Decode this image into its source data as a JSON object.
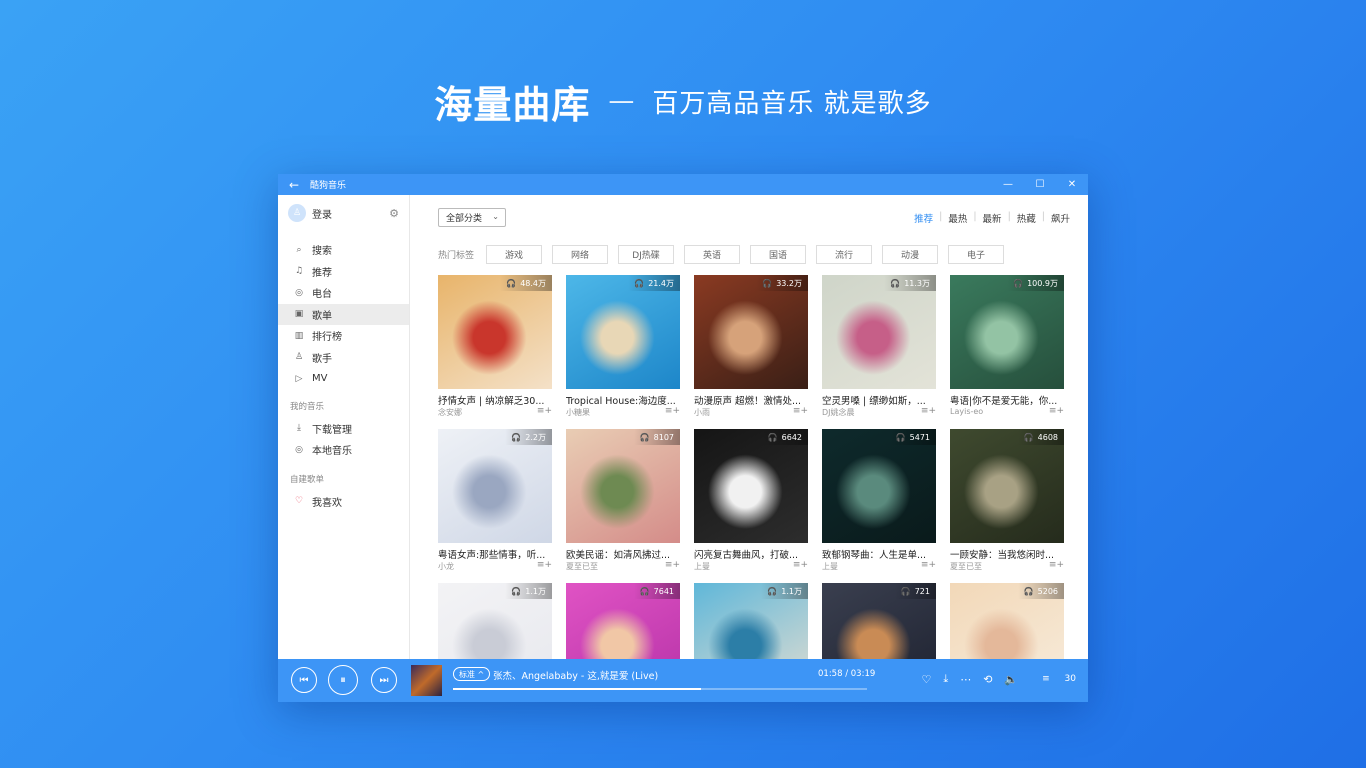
{
  "hero": {
    "title": "海量曲库",
    "dash": "—",
    "subtitle": "百万高品音乐 就是歌多"
  },
  "window": {
    "app_name": "酷狗音乐",
    "back_icon": "←",
    "min_icon": "—",
    "max_icon": "☐",
    "close_icon": "✕"
  },
  "sidebar": {
    "login_label": "登录",
    "nav": [
      {
        "label": "搜索",
        "icon": "⌕"
      },
      {
        "label": "推荐",
        "icon": "♫"
      },
      {
        "label": "电台",
        "icon": "◎"
      },
      {
        "label": "歌单",
        "icon": "▣"
      },
      {
        "label": "排行榜",
        "icon": "▥"
      },
      {
        "label": "歌手",
        "icon": "♙"
      },
      {
        "label": "MV",
        "icon": "▷"
      }
    ],
    "my_music_title": "我的音乐",
    "my_music": [
      {
        "label": "下载管理",
        "icon": "⤓"
      },
      {
        "label": "本地音乐",
        "icon": "◎"
      }
    ],
    "playlists_title": "自建歌单",
    "playlists": [
      {
        "label": "我喜欢",
        "icon": "♡"
      }
    ]
  },
  "main": {
    "category": "全部分类",
    "sorts": [
      "推荐",
      "最热",
      "最新",
      "热藏",
      "飙升"
    ],
    "tags_label": "热门标签",
    "tags": [
      "游戏",
      "网络",
      "DJ热碟",
      "英语",
      "国语",
      "流行",
      "动漫",
      "电子"
    ],
    "cards": [
      {
        "plays": "48.4万",
        "title": "抒情女声 | 纳凉解乏30...",
        "author": "念安娜",
        "colors": [
          "#e8b46a",
          "#c9362c",
          "#f4e1c8"
        ]
      },
      {
        "plays": "21.4万",
        "title": "Tropical House:海边度...",
        "author": "小糖果",
        "colors": [
          "#4db7e8",
          "#e8d7b6",
          "#1d86c9"
        ]
      },
      {
        "plays": "33.2万",
        "title": "动漫原声 超燃！激情处...",
        "author": "小雨",
        "colors": [
          "#8a3a22",
          "#d6a27a",
          "#3a1f16"
        ]
      },
      {
        "plays": "11.3万",
        "title": "空灵男嗓 | 缥缈如斯，...",
        "author": "DJ姚念晨",
        "colors": [
          "#cfd5c9",
          "#c65f88",
          "#e3e3d8"
        ]
      },
      {
        "plays": "100.9万",
        "title": "粤语|你不是爱无能，你...",
        "author": "Layis-eo",
        "colors": [
          "#3a7a5d",
          "#93c3a4",
          "#264f3c"
        ]
      },
      {
        "plays": "2.2万",
        "title": "粤语女声:那些情事，听...",
        "author": "小龙",
        "colors": [
          "#eef1f6",
          "#9aa7c1",
          "#cfd7e6"
        ]
      },
      {
        "plays": "8107",
        "title": "欧美民谣：如清风拂过...",
        "author": "夏至已至",
        "colors": [
          "#e9cdb4",
          "#6e8a52",
          "#d48c89"
        ]
      },
      {
        "plays": "6642",
        "title": "闪亮复古舞曲风，打破...",
        "author": "上曼",
        "colors": [
          "#151515",
          "#f1f1f1",
          "#2d2d2d"
        ]
      },
      {
        "plays": "5471",
        "title": "致郁钢琴曲：人生是单...",
        "author": "上曼",
        "colors": [
          "#0e2a2c",
          "#5a8a7d",
          "#0a1a1b"
        ]
      },
      {
        "plays": "4608",
        "title": "一顾安静：当我悠闲时...",
        "author": "夏至已至",
        "colors": [
          "#3f4a2f",
          "#a8a184",
          "#252b1c"
        ]
      },
      {
        "plays": "1.1万",
        "title": "",
        "author": "",
        "colors": [
          "#f3f3f5",
          "#c9ccd6",
          "#e7e8ee"
        ]
      },
      {
        "plays": "7641",
        "title": "",
        "author": "",
        "colors": [
          "#e053c4",
          "#f1c7a6",
          "#b733a8"
        ]
      },
      {
        "plays": "1.1万",
        "title": "",
        "author": "",
        "colors": [
          "#5fb7d9",
          "#2c7ea7",
          "#e2ddd1"
        ]
      },
      {
        "plays": "721",
        "title": "",
        "author": "",
        "colors": [
          "#3a3f4f",
          "#c98b55",
          "#1e2230"
        ]
      },
      {
        "plays": "5206",
        "title": "",
        "author": "",
        "colors": [
          "#f2d8b8",
          "#e4b89a",
          "#f7ecdc"
        ]
      }
    ]
  },
  "player": {
    "prev_icon": "⏮",
    "play_icon": "⏸",
    "next_icon": "⏭",
    "quality": "标准 ^",
    "song": "张杰、Angelababy - 这,就是爱 (Live)",
    "time": "01:58 / 03:19",
    "progress": 0.6,
    "icons": [
      "♡",
      "⤓",
      "⋯",
      "⟲",
      "🔈"
    ],
    "playlist_count": "30",
    "playlist_icon": "≡"
  }
}
